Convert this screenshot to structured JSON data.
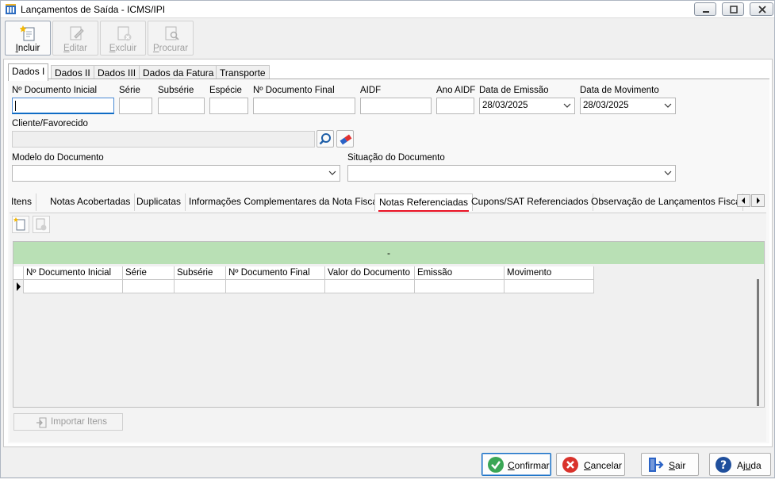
{
  "window": {
    "title": "Lançamentos de Saída - ICMS/IPI"
  },
  "toolbar": {
    "include": "Incluir",
    "include_u": "I",
    "include_rest": "ncluir",
    "edit": "Editar",
    "edit_u": "E",
    "edit_rest": "ditar",
    "delete": "Excluir",
    "delete_u": "E",
    "delete_rest": "xcluir",
    "search": "Procurar",
    "search_u": "P",
    "search_rest": "rocurar"
  },
  "tabs": [
    "Dados I",
    "Dados II",
    "Dados III",
    "Dados da Fatura",
    "Transporte"
  ],
  "form": {
    "doc_inicial_label": "Nº Documento Inicial",
    "serie_label": "Série",
    "subserie_label": "Subsérie",
    "especie_label": "Espécie",
    "doc_final_label": "Nº Documento Final",
    "aidf_label": "AIDF",
    "ano_aidf_label": "Ano AIDF",
    "data_emissao_label": "Data de Emissão",
    "data_emissao_value": "28/03/2025",
    "data_movimento_label": "Data de Movimento",
    "data_movimento_value": "28/03/2025",
    "cliente_label": "Cliente/Favorecido",
    "modelo_label": "Modelo do Documento",
    "situacao_label": "Situação do Documento"
  },
  "inner_tabs": [
    "Itens",
    "Notas Acobertadas",
    "Duplicatas",
    "Informações Complementares da Nota Fiscal",
    "Notas Referenciadas",
    "Cupons/SAT Referenciados",
    "Observação de Lançamentos Fiscais (C"
  ],
  "grid": {
    "group_header": "-",
    "columns": [
      "Nº Documento Inicial",
      "Série",
      "Subsérie",
      "Nº Documento Final",
      "Valor do Documento",
      "Emissão",
      "Movimento"
    ]
  },
  "import_button": "Importar Itens",
  "footer": {
    "confirm": "Confirmar",
    "confirm_u": "C",
    "confirm_rest": "onfirmar",
    "cancel": "Cancelar",
    "cancel_u": "C",
    "cancel_rest": "ancelar",
    "exit": "Sair",
    "exit_u": "S",
    "exit_rest": "air",
    "help": "Ajuda",
    "help_u": "A",
    "help_pre": "Aj",
    "help_mid": "u",
    "help_rest": "da"
  },
  "colors": {
    "accent": "#0f6cc5",
    "grid_header": "#b9e0b5",
    "tab_underline": "#e81123"
  }
}
